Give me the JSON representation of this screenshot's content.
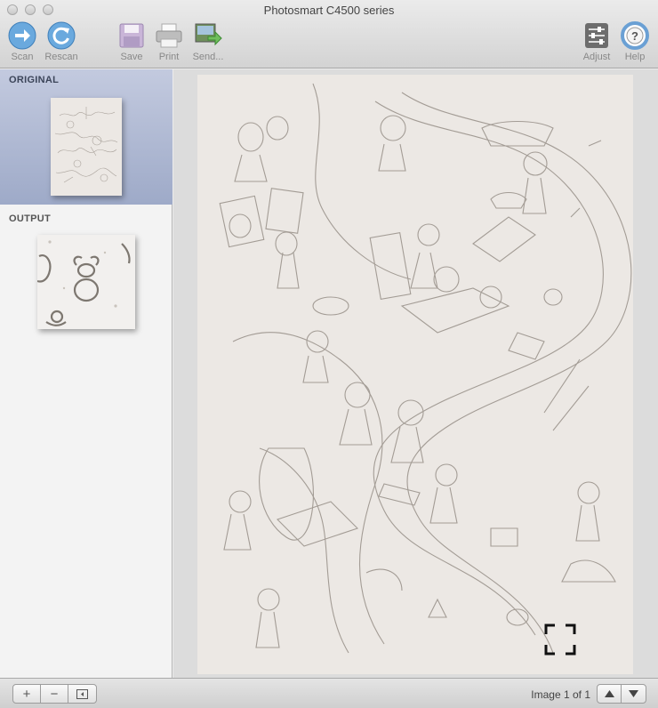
{
  "window": {
    "title": "Photosmart C4500 series"
  },
  "toolbar": {
    "scan": "Scan",
    "rescan": "Rescan",
    "save": "Save",
    "print": "Print",
    "send": "Send...",
    "adjust": "Adjust",
    "help": "Help"
  },
  "sidebar": {
    "original_label": "ORIGINAL",
    "output_label": "OUTPUT"
  },
  "footer": {
    "page_count": "Image 1 of 1"
  },
  "icons": {
    "scan": "arrow-right-circle-icon",
    "rescan": "rotate-circle-icon",
    "save": "floppy-disk-icon",
    "print": "printer-icon",
    "send": "send-image-icon",
    "adjust": "sliders-icon",
    "help": "help-lifebuoy-icon",
    "add": "plus-icon",
    "remove": "minus-icon",
    "panel": "panel-toggle-icon",
    "prev": "arrow-up-icon",
    "next": "arrow-down-icon"
  },
  "colors": {
    "accent_blue": "#5a9bd4",
    "selection_bg": "#a6b1cd"
  }
}
